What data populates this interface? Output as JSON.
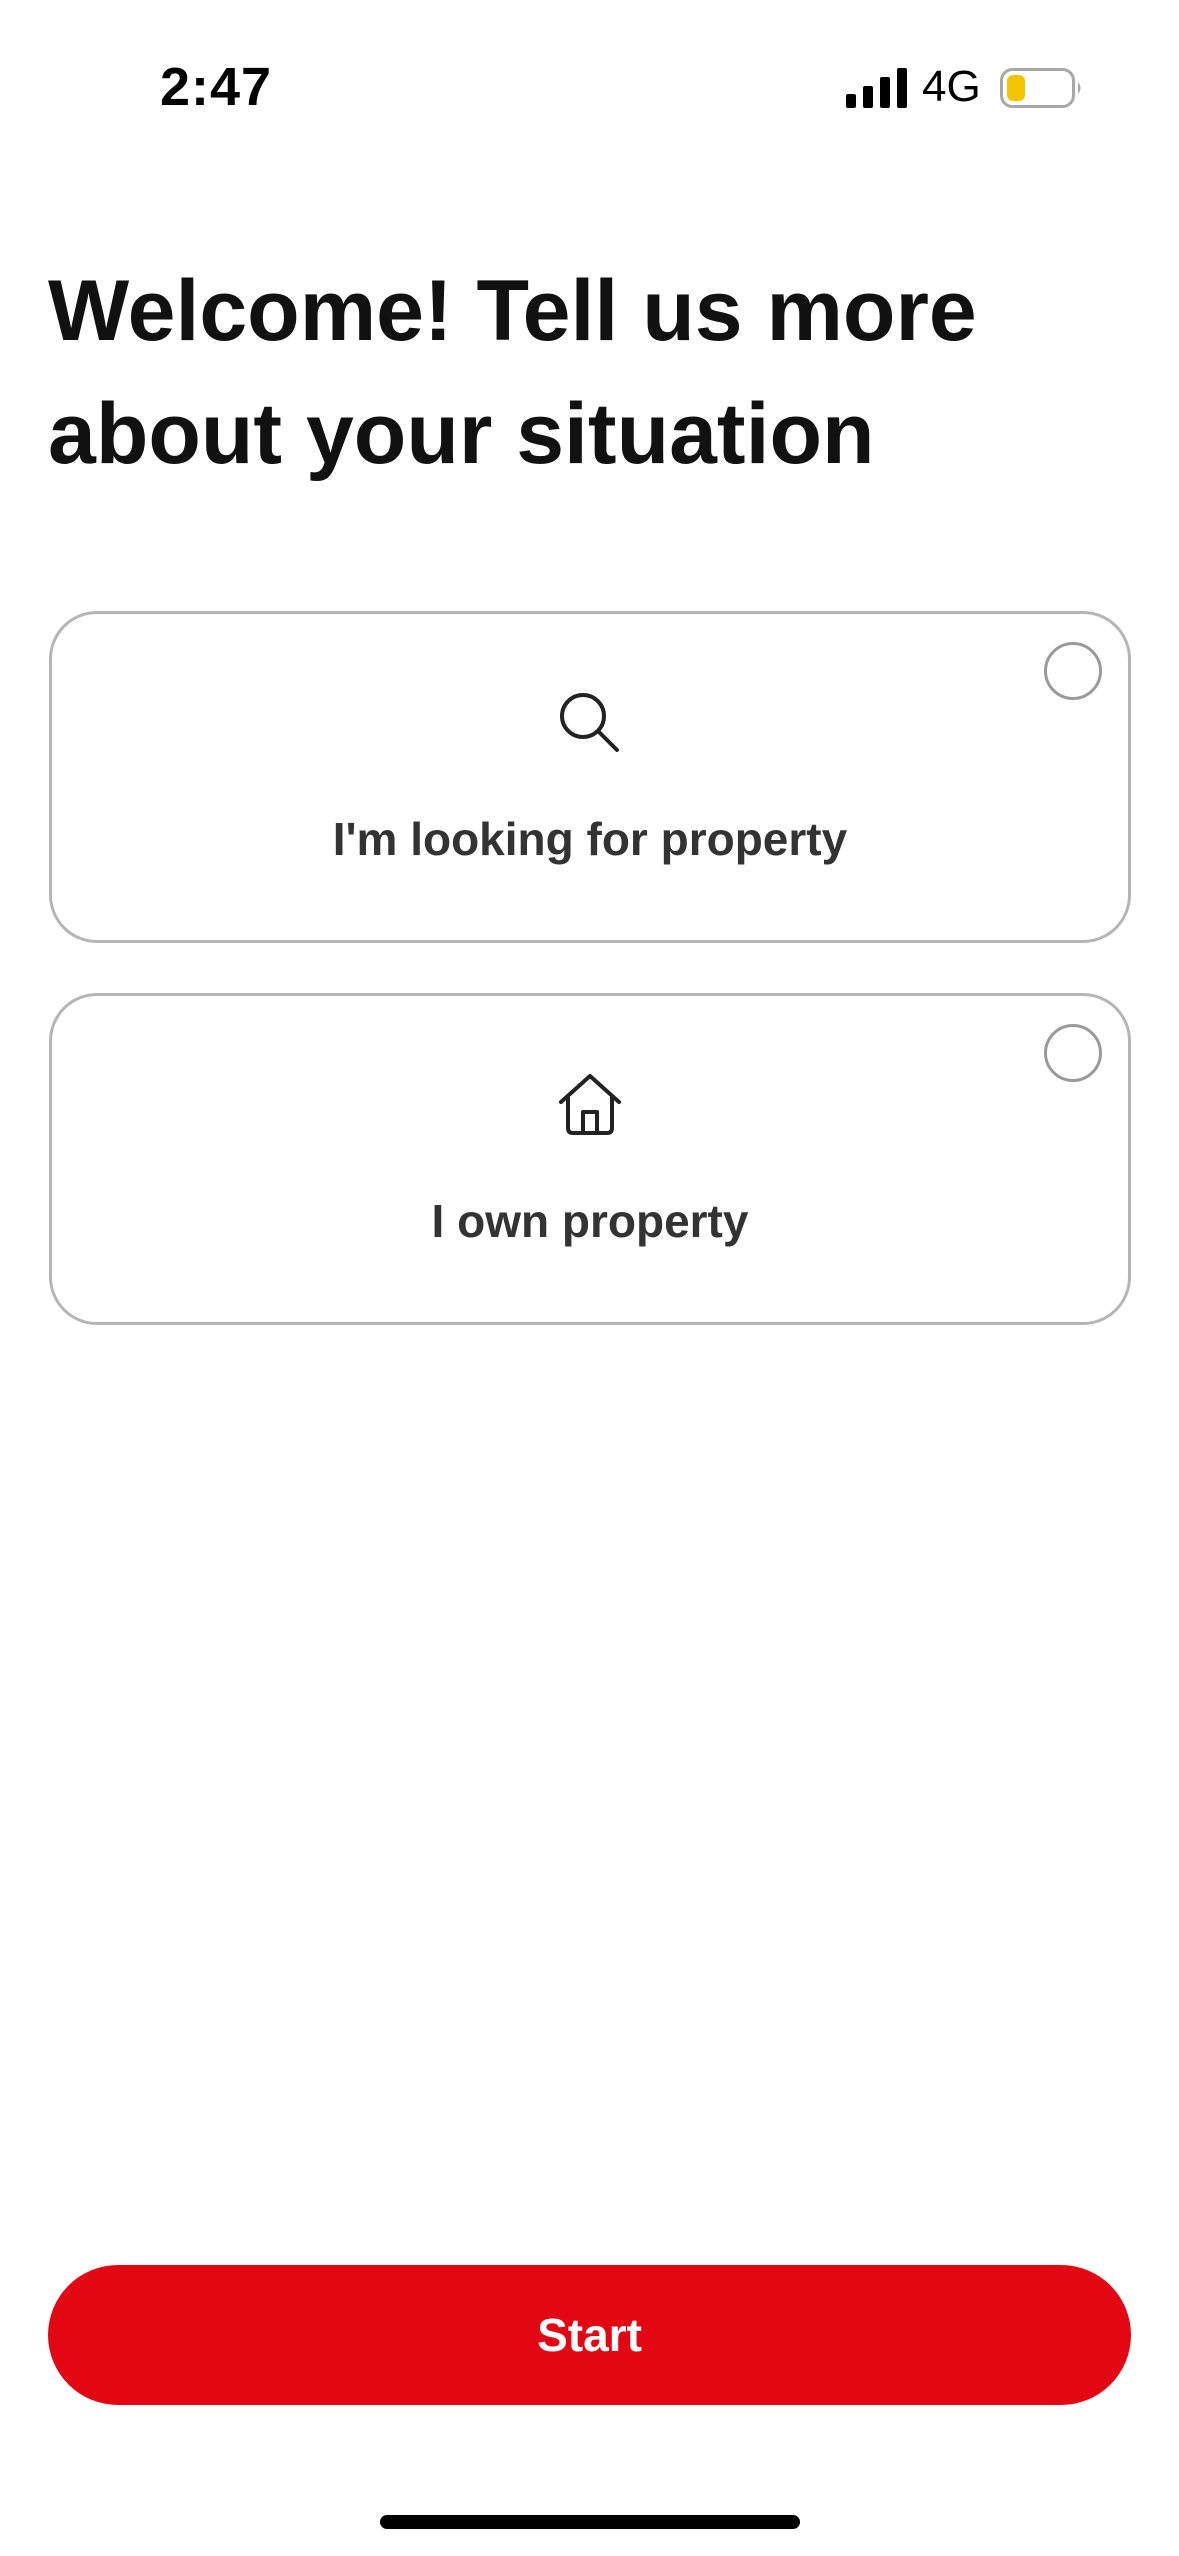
{
  "status_bar": {
    "time": "2:47",
    "network": "4G",
    "icons": [
      "signal-icon",
      "battery-icon"
    ],
    "battery_color": "#f5c400"
  },
  "header": {
    "title": "Welcome! Tell us more about your situation"
  },
  "options": [
    {
      "label": "I'm looking for property",
      "icon": "search-icon",
      "selected": false
    },
    {
      "label": "I own property",
      "icon": "house-icon",
      "selected": false
    }
  ],
  "footer": {
    "start_label": "Start",
    "button_color": "#e30613"
  }
}
